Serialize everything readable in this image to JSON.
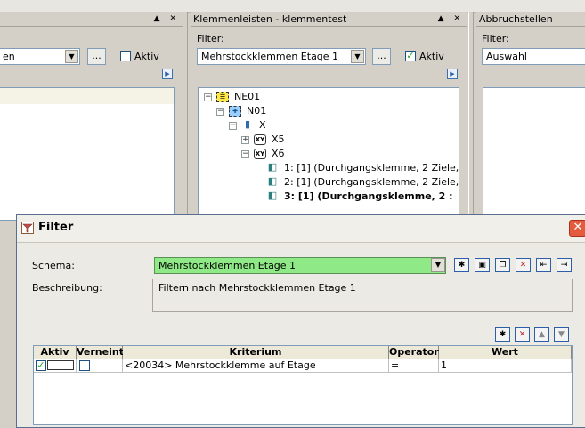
{
  "left_panel": {
    "combo_value": "en",
    "aktiv_label": "Aktiv",
    "dots_label": "..."
  },
  "middle_panel": {
    "title": "Klemmenleisten - klemmentest",
    "filter_label": "Filter:",
    "combo_value": "Mehrstockklemmen Etage 1",
    "dots_label": "...",
    "aktiv_label": "Aktiv",
    "aktiv_checked": true,
    "tree": [
      {
        "label": "NE01",
        "level": 0,
        "expander": "minus",
        "icon": "rack-icon"
      },
      {
        "label": "N01",
        "level": 1,
        "expander": "minus",
        "icon": "node-icon"
      },
      {
        "label": "X",
        "level": 2,
        "expander": "minus",
        "icon": "folder-icon"
      },
      {
        "label": "X5",
        "level": 3,
        "expander": "plus",
        "icon": "xy-icon"
      },
      {
        "label": "X6",
        "level": 3,
        "expander": "minus",
        "icon": "xy-icon"
      },
      {
        "label": "1: [1] (Durchgangsklemme, 2 Ziele,",
        "level": 4,
        "expander": "none",
        "icon": "terminal-icon",
        "bold": false
      },
      {
        "label": "2: [1] (Durchgangsklemme, 2 Ziele,",
        "level": 4,
        "expander": "none",
        "icon": "terminal-icon",
        "bold": false
      },
      {
        "label": "3: [1] (Durchgangsklemme, 2 :",
        "level": 4,
        "expander": "none",
        "icon": "terminal-icon",
        "bold": true
      }
    ]
  },
  "right_panel": {
    "title": "Abbruchstellen",
    "filter_label": "Filter:",
    "combo_value": "Auswahl"
  },
  "dialog": {
    "title": "Filter",
    "schema_label": "Schema:",
    "schema_value": "Mehrstockklemmen Etage 1",
    "beschreibung_label": "Beschreibung:",
    "beschreibung_value": "Filtern nach Mehrstockklemmen Etage 1",
    "grid": {
      "headers": [
        "Aktiv",
        "Verneint",
        "Kriterium",
        "Operator",
        "Wert"
      ],
      "rows": [
        {
          "aktiv": true,
          "verneint": false,
          "kriterium": "<20034> Mehrstockklemme auf Etage",
          "operator": "=",
          "wert": "1"
        }
      ]
    }
  }
}
